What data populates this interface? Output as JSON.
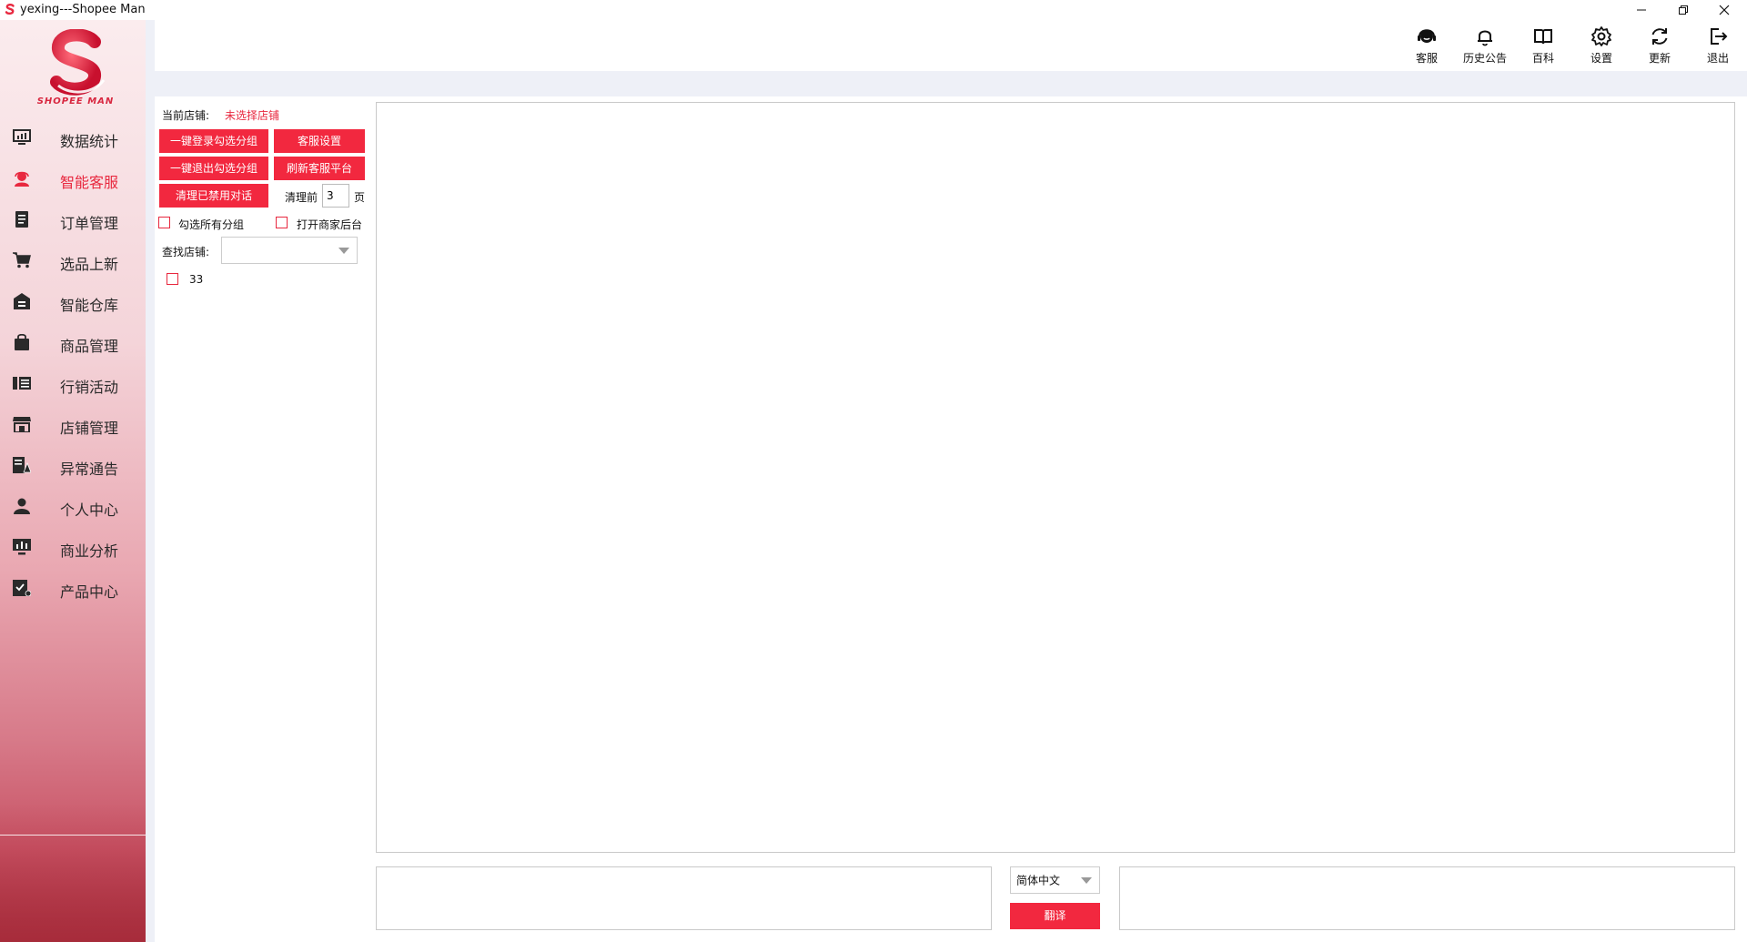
{
  "window": {
    "title": "yexing---Shopee Man"
  },
  "logo": {
    "brand_text": "SHOPEE MAN",
    "accent_color": "#e8283f"
  },
  "sidebar": {
    "items": [
      {
        "label": "数据统计",
        "icon": "monitor-chart-icon",
        "active": false
      },
      {
        "label": "智能客服",
        "icon": "user-headset-icon",
        "active": true
      },
      {
        "label": "订单管理",
        "icon": "document-list-icon",
        "active": false
      },
      {
        "label": "选品上新",
        "icon": "shopping-cart-icon",
        "active": false
      },
      {
        "label": "智能仓库",
        "icon": "warehouse-icon",
        "active": false
      },
      {
        "label": "商品管理",
        "icon": "shopping-bag-icon",
        "active": false
      },
      {
        "label": "行销活动",
        "icon": "list-bars-icon",
        "active": false
      },
      {
        "label": "店铺管理",
        "icon": "storefront-icon",
        "active": false
      },
      {
        "label": "异常通告",
        "icon": "alert-notice-icon",
        "active": false
      },
      {
        "label": "个人中心",
        "icon": "person-icon",
        "active": false
      },
      {
        "label": "商业分析",
        "icon": "analytics-monitor-icon",
        "active": false
      },
      {
        "label": "产品中心",
        "icon": "product-box-icon",
        "active": false
      }
    ]
  },
  "toolbar": {
    "items": [
      {
        "label": "客服",
        "icon": "headset-icon"
      },
      {
        "label": "历史公告",
        "icon": "bell-icon"
      },
      {
        "label": "百科",
        "icon": "book-icon"
      },
      {
        "label": "设置",
        "icon": "gear-icon"
      },
      {
        "label": "更新",
        "icon": "refresh-icon"
      },
      {
        "label": "退出",
        "icon": "logout-icon"
      }
    ]
  },
  "panel": {
    "current_shop_label": "当前店铺:",
    "current_shop_value": "未选择店铺",
    "btn_login_group": "一键登录勾选分组",
    "btn_service_settings": "客服设置",
    "btn_logout_group": "一键退出勾选分组",
    "btn_refresh_platform": "刷新客服平台",
    "btn_clear_disabled": "清理已禁用对话",
    "clear_before_label": "清理前",
    "clear_pages_value": "3",
    "pages_unit": "页",
    "check_all_groups": "勾选所有分组",
    "open_merchant_backend": "打开商家后台",
    "find_shop_label": "查找店铺:",
    "find_shop_value": "",
    "group_items": [
      {
        "label": "33",
        "checked": false
      }
    ]
  },
  "translate": {
    "language": "简体中文",
    "button_label": "翻译"
  }
}
